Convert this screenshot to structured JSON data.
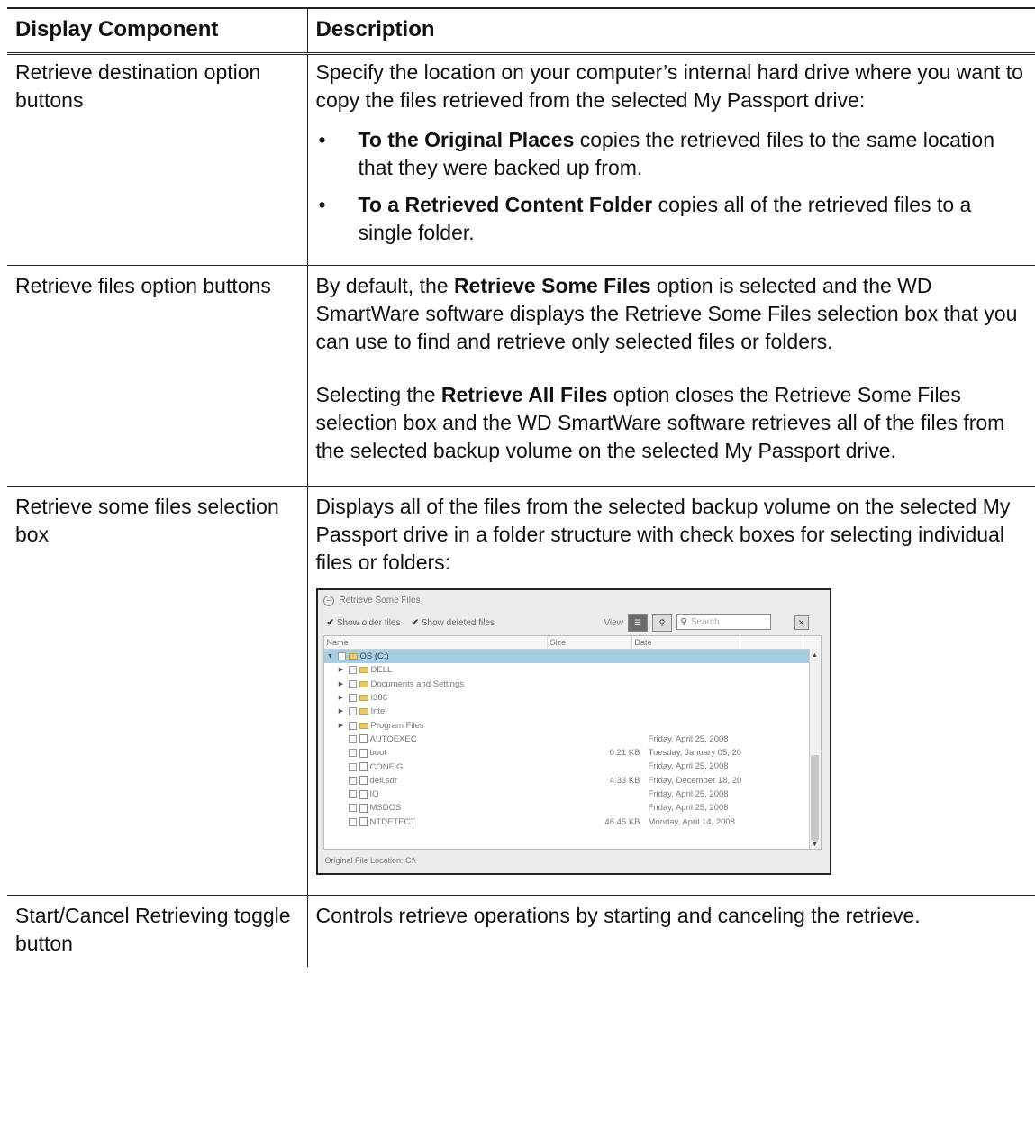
{
  "table": {
    "headers": [
      "Display Component",
      "Description"
    ],
    "rows": [
      {
        "component": "Retrieve destination option buttons",
        "intro": "Specify the location on your computer’s internal hard drive where you want to copy the files retrieved from the selected My Passport drive:",
        "bullets": [
          {
            "bold": "To the Original Places",
            "text": " copies the retrieved files to the same location that they were backed up from."
          },
          {
            "bold": "To a Retrieved Content Folder",
            "text": " copies all of the retrieved files to a single folder."
          }
        ]
      },
      {
        "component": "Retrieve files option buttons",
        "p1_pre": "By default, the ",
        "p1_bold": "Retrieve Some Files",
        "p1_post": " option is selected and the WD SmartWare software displays the Retrieve Some Files selection box that you can use to find and retrieve only selected files or folders.",
        "p2_pre": "Selecting the ",
        "p2_bold": "Retrieve All Files",
        "p2_post": " option closes the Retrieve Some Files selection box and the WD SmartWare software retrieves all of the files from the selected backup volume on the selected My Passport drive."
      },
      {
        "component": "Retrieve some files selection box",
        "text": "Displays all of the files from the selected backup volume on the selected My Passport drive in a folder structure with check boxes for selecting individual files or folders:"
      },
      {
        "component": "Start/Cancel Retrieving toggle button",
        "text": "Controls retrieve operations by starting and canceling the retrieve."
      }
    ]
  },
  "screenshot": {
    "title": "Retrieve Some Files",
    "show_older": "Show older files",
    "show_deleted": "Show deleted files",
    "view_label": "View",
    "search_placeholder": "Search",
    "columns": [
      "Name",
      "Size",
      "Date"
    ],
    "items": [
      {
        "name": "OS (C:)",
        "size": "",
        "date": "",
        "kind": "drive"
      },
      {
        "name": "DELL",
        "size": "",
        "date": "",
        "kind": "folder"
      },
      {
        "name": "Documents and Settings",
        "size": "",
        "date": "",
        "kind": "folder"
      },
      {
        "name": "I386",
        "size": "",
        "date": "",
        "kind": "folder"
      },
      {
        "name": "Intel",
        "size": "",
        "date": "",
        "kind": "folder"
      },
      {
        "name": "Program Files",
        "size": "",
        "date": "",
        "kind": "folder"
      },
      {
        "name": "AUTOEXEC",
        "size": "",
        "date": "Friday, April 25, 2008",
        "kind": "file"
      },
      {
        "name": "boot",
        "size": "0.21 KB",
        "date": "Tuesday, January 05, 20",
        "kind": "file"
      },
      {
        "name": "CONFIG",
        "size": "",
        "date": "Friday, April 25, 2008",
        "kind": "file"
      },
      {
        "name": "dell.sdr",
        "size": "4.33 KB",
        "date": "Friday, December 18, 20",
        "kind": "file"
      },
      {
        "name": "IO",
        "size": "",
        "date": "Friday, April 25, 2008",
        "kind": "file"
      },
      {
        "name": "MSDOS",
        "size": "",
        "date": "Friday, April 25, 2008",
        "kind": "file"
      },
      {
        "name": "NTDETECT",
        "size": "46.45 KB",
        "date": "Monday, April 14, 2008",
        "kind": "file"
      }
    ],
    "footer": "Original File Location:  C:\\"
  }
}
